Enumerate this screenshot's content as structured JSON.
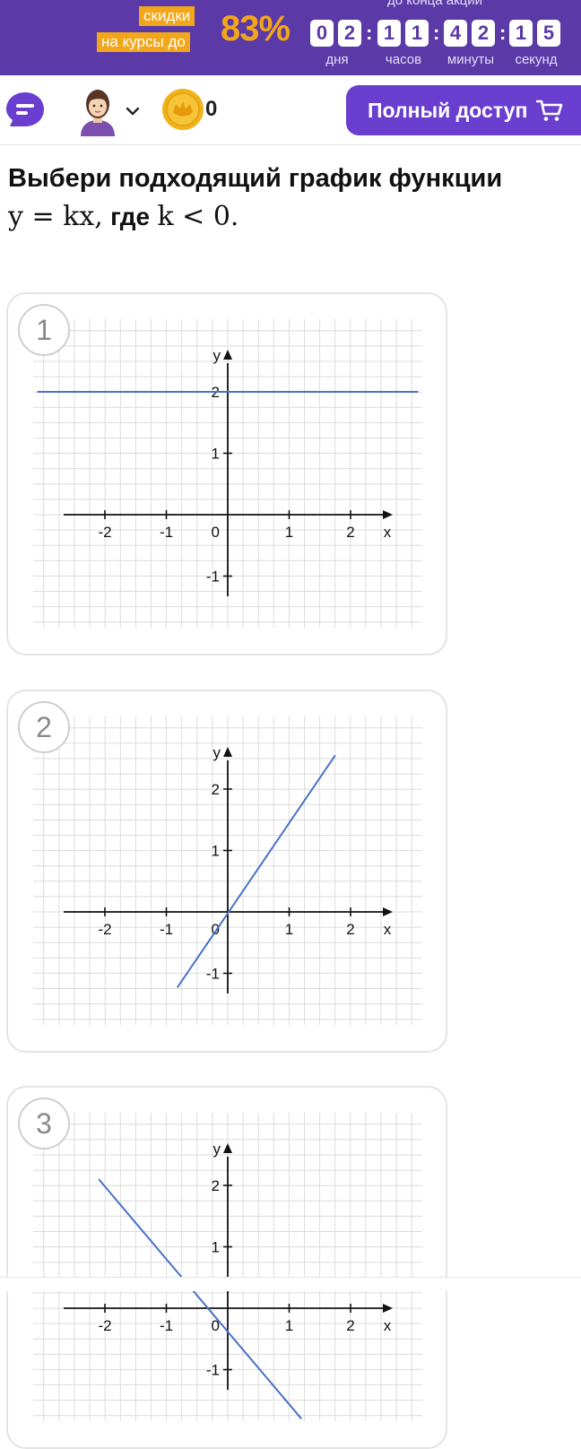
{
  "promo": {
    "tag_line1": "скидки",
    "tag_line2": "на курсы до",
    "percent": "83%",
    "until_label": "до конца акции",
    "digits": [
      "0",
      "2",
      "1",
      "1",
      "4",
      "2",
      "1",
      "5"
    ],
    "labels": [
      "дня",
      "часов",
      "минуты",
      "секунд"
    ]
  },
  "nav": {
    "coin_count": "0",
    "full_access_label": "Полный доступ"
  },
  "question": {
    "title": "Выбери подходящий график функции",
    "formula_part1": "y = kx,",
    "formula_bold": "где",
    "formula_part2": "k < 0."
  },
  "options": [
    {
      "number": "1"
    },
    {
      "number": "2"
    },
    {
      "number": "3"
    }
  ],
  "graph_labels": {
    "x_axis": "x",
    "y_axis": "y",
    "origin": "0",
    "x_ticks": [
      "-2",
      "-1",
      "1",
      "2"
    ],
    "y_ticks": [
      "2",
      "1",
      "-1"
    ]
  },
  "chart_data": [
    {
      "type": "line",
      "title": "",
      "xlabel": "x",
      "ylabel": "y",
      "xlim": [
        -2.7,
        2.7
      ],
      "ylim": [
        -1.3,
        2.6
      ],
      "series": [
        {
          "x": [
            -3.1,
            3.1
          ],
          "y": [
            2,
            2
          ]
        }
      ],
      "colors": [
        "#4a72c8"
      ],
      "grid": true
    },
    {
      "type": "line",
      "title": "",
      "xlabel": "x",
      "ylabel": "y",
      "xlim": [
        -2.7,
        2.7
      ],
      "ylim": [
        -1.3,
        2.6
      ],
      "series": [
        {
          "x": [
            -0.82,
            1.75
          ],
          "y": [
            -1.23,
            2.55
          ]
        }
      ],
      "colors": [
        "#4a72c8"
      ],
      "grid": true
    },
    {
      "type": "line",
      "title": "",
      "xlabel": "x",
      "ylabel": "y",
      "xlim": [
        -2.7,
        2.7
      ],
      "ylim": [
        -1.3,
        2.6
      ],
      "series": [
        {
          "x": [
            -2.1,
            1.2
          ],
          "y": [
            2.1,
            -1.8
          ]
        }
      ],
      "colors": [
        "#4a72c8"
      ],
      "grid": true
    }
  ],
  "colors": {
    "brand_purple": "#5b3aa8",
    "button_purple": "#6a3fcf",
    "accent_orange": "#f2a619",
    "graph_line": "#4a72c8",
    "grid": "#dcdcdc"
  }
}
